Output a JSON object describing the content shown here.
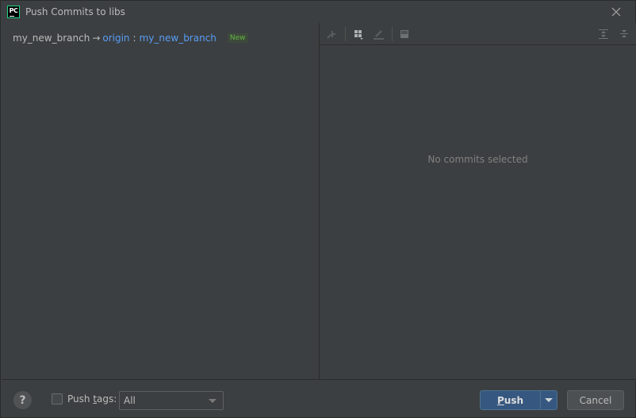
{
  "window": {
    "title": "Push Commits to libs",
    "app_icon_label": "PC"
  },
  "left_panel": {
    "local_branch": "my_new_branch",
    "arrow": "→",
    "remote": "origin",
    "separator": ":",
    "remote_branch": "my_new_branch",
    "badge": "New"
  },
  "right_panel": {
    "toolbar": {
      "icons": [
        "cherry-pick-icon",
        "group-by-icon",
        "edit-icon",
        "diff-icon",
        "expand-all-icon",
        "collapse-all-icon"
      ]
    },
    "empty_text": "No commits selected"
  },
  "footer": {
    "help_label": "?",
    "push_tags_label_pre": "Push ",
    "push_tags_label_mnemonic": "t",
    "push_tags_label_post": "ags:",
    "push_tags_checked": false,
    "tags_select_value": "All",
    "push_label_mnemonic": "P",
    "push_label_rest": "ush",
    "cancel_label": "Cancel"
  },
  "colors": {
    "background": "#3c3f41",
    "link": "#589df6",
    "badge_text": "#62b543",
    "primary_button": "#365880"
  }
}
